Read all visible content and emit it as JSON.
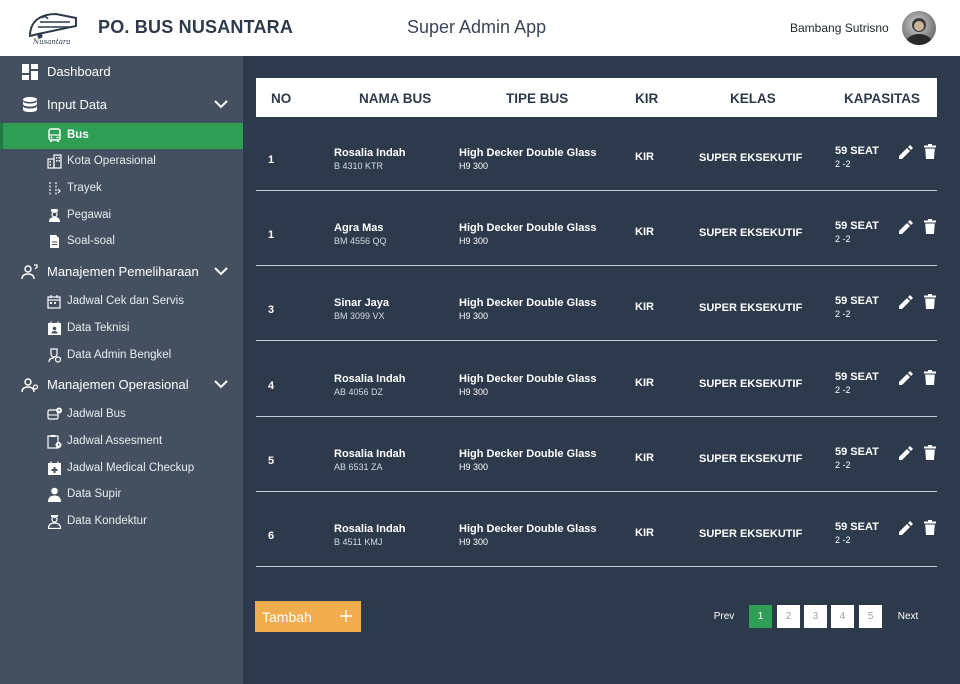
{
  "header": {
    "logo_text": "Nusantara",
    "brand": "PO. BUS NUSANTARA",
    "app_title": "Super Admin App",
    "user_name": "Bambang Sutrisno"
  },
  "sidebar": {
    "dashboard": "Dashboard",
    "input_data": "Input Data",
    "bus": "Bus",
    "kota_operasional": "Kota Operasional",
    "trayek": "Trayek",
    "pegawai": "Pegawai",
    "soal_soal": "Soal-soal",
    "manajemen_pemeliharaan": "Manajemen Pemeliharaan",
    "jadwal_cek_servis": "Jadwal Cek dan Servis",
    "data_teknisi": "Data Teknisi",
    "data_admin_bengkel": "Data Admin Bengkel",
    "manajemen_operasional": "Manajemen Operasional",
    "jadwal_bus": "Jadwal Bus",
    "jadwal_assesment": "Jadwal Assesment",
    "jadwal_medical_checkup": "Jadwal Medical Checkup",
    "data_supir": "Data Supir",
    "data_kondektur": "Data Kondektur"
  },
  "table": {
    "headers": {
      "no": "NO",
      "nama_bus": "NAMA BUS",
      "tipe_bus": "TIPE BUS",
      "kir": "KIR",
      "kelas": "KELAS",
      "kapasitas": "KAPASITAS"
    },
    "rows": [
      {
        "no": "1",
        "nama": "Rosalia Indah",
        "plat": "B 4310 KTR",
        "tipe": "High Decker Double Glass",
        "tipe_sub": "H9 300",
        "kir": "KIR",
        "kelas": "SUPER EKSEKUTIF",
        "kapasitas": "59 SEAT",
        "konfigurasi": "2 -2"
      },
      {
        "no": "1",
        "nama": "Agra Mas",
        "plat": "BM 4556 QQ",
        "tipe": "High Decker Double Glass",
        "tipe_sub": "H9 300",
        "kir": "KIR",
        "kelas": "SUPER EKSEKUTIF",
        "kapasitas": "59 SEAT",
        "konfigurasi": "2 -2"
      },
      {
        "no": "3",
        "nama": "Sinar Jaya",
        "plat": "BM 3099 VX",
        "tipe": "High Decker Double Glass",
        "tipe_sub": "H9 300",
        "kir": "KIR",
        "kelas": "SUPER EKSEKUTIF",
        "kapasitas": "59 SEAT",
        "konfigurasi": "2 -2"
      },
      {
        "no": "4",
        "nama": "Rosalia Indah",
        "plat": "AB 4056 DZ",
        "tipe": "High Decker Double Glass",
        "tipe_sub": "H9 300",
        "kir": "KIR",
        "kelas": "SUPER EKSEKUTIF",
        "kapasitas": "59 SEAT",
        "konfigurasi": "2 -2"
      },
      {
        "no": "5",
        "nama": "Rosalia Indah",
        "plat": "AB 6531 ZA",
        "tipe": "High Decker Double Glass",
        "tipe_sub": "H9 300",
        "kir": "KIR",
        "kelas": "SUPER EKSEKUTIF",
        "kapasitas": "59 SEAT",
        "konfigurasi": "2 -2"
      },
      {
        "no": "6",
        "nama": "Rosalia Indah",
        "plat": "B 4511 KMJ",
        "tipe": "High Decker Double Glass",
        "tipe_sub": "H9 300",
        "kir": "KIR",
        "kelas": "SUPER EKSEKUTIF",
        "kapasitas": "59 SEAT",
        "konfigurasi": "2 -2"
      }
    ]
  },
  "actions": {
    "tambah": "Tambah"
  },
  "pagination": {
    "prev": "Prev",
    "pages": [
      "1",
      "2",
      "3",
      "4",
      "5"
    ],
    "next": "Next"
  },
  "colors": {
    "accent_green": "#2e9e55",
    "add_orange": "#f0ad4e",
    "sidebar_bg": "#44505f",
    "content_bg": "#2d3a4b"
  }
}
